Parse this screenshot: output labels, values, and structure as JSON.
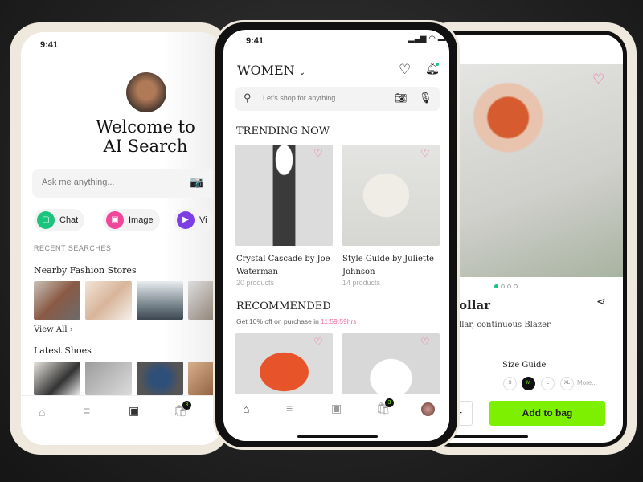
{
  "left_phone": {
    "time": "9:41",
    "title_line1": "Welcome to",
    "title_line2": "AI Search",
    "search_placeholder": "Ask me anything...",
    "chips": [
      {
        "label": "Chat",
        "color": "#1bc47d",
        "icon": "chat-bot-icon"
      },
      {
        "label": "Image",
        "color": "#f0479a",
        "icon": "image-icon"
      },
      {
        "label": "Vi",
        "color": "#7b3fe4",
        "icon": "video-icon"
      }
    ],
    "recent_searches": "RECENT SEARCHES",
    "nearby_title": "Nearby Fashion Stores",
    "view_all": "View All",
    "latest_shoes": "Latest Shoes",
    "cart_count": "3"
  },
  "middle_phone": {
    "time": "9:41",
    "category": "WOMEN",
    "search_placeholder": "Let's shop for anything..",
    "trending_title": "TRENDING NOW",
    "trending": [
      {
        "title": "Crystal Cascade by Joe Waterman",
        "count": "20 products"
      },
      {
        "title": "Style Guide by Juliette Johnson",
        "count": "14 products"
      }
    ],
    "recommended_title": "RECOMMENDED",
    "offer_text": "Get 10% off on purchase in",
    "offer_timer": "11:59:59hrs",
    "cart_count": "3",
    "accent": "#f06aa0"
  },
  "right_phone": {
    "product_title": "ollar",
    "product_subtitle": "llar, continuous Blazer",
    "size_guide": "Size Guide",
    "sizes": [
      "S",
      "M",
      "L",
      "XL"
    ],
    "selected_size": "M",
    "more_sizes": "More...",
    "quantity_button": "+",
    "add_to_bag": "Add to bag",
    "carousel_index": 1,
    "carousel_total": 4,
    "button_color": "#7cf000"
  }
}
